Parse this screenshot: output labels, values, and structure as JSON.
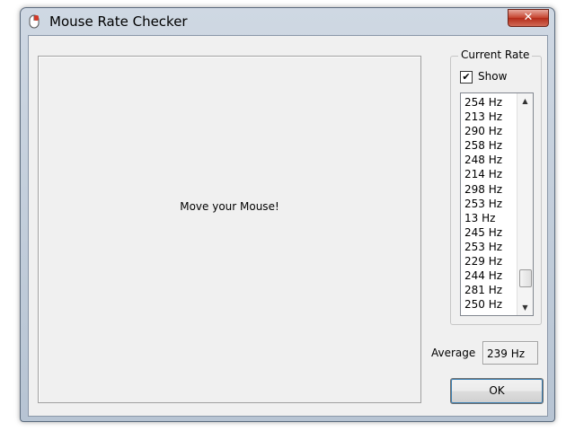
{
  "window": {
    "title": "Mouse Rate Checker",
    "close_glyph": "✕"
  },
  "canvas": {
    "prompt": "Move your Mouse!"
  },
  "current_rate": {
    "group_label": "Current Rate",
    "show_label": "Show",
    "show_checked": true,
    "check_glyph": "✔",
    "items": [
      "254 Hz",
      "213 Hz",
      "290 Hz",
      "258 Hz",
      "248 Hz",
      "214 Hz",
      "298 Hz",
      "253 Hz",
      "13 Hz",
      "245 Hz",
      "253 Hz",
      "229 Hz",
      "244 Hz",
      "281 Hz",
      "250 Hz"
    ],
    "scroll_up_glyph": "▲",
    "scroll_down_glyph": "▼"
  },
  "average": {
    "label": "Average",
    "value": "239 Hz"
  },
  "buttons": {
    "ok_label": "OK"
  },
  "icons": {
    "app": "mouse-app-icon",
    "close": "close-icon"
  },
  "colors": {
    "close_red": "#c4412c",
    "client_bg": "#f0f0f0"
  }
}
